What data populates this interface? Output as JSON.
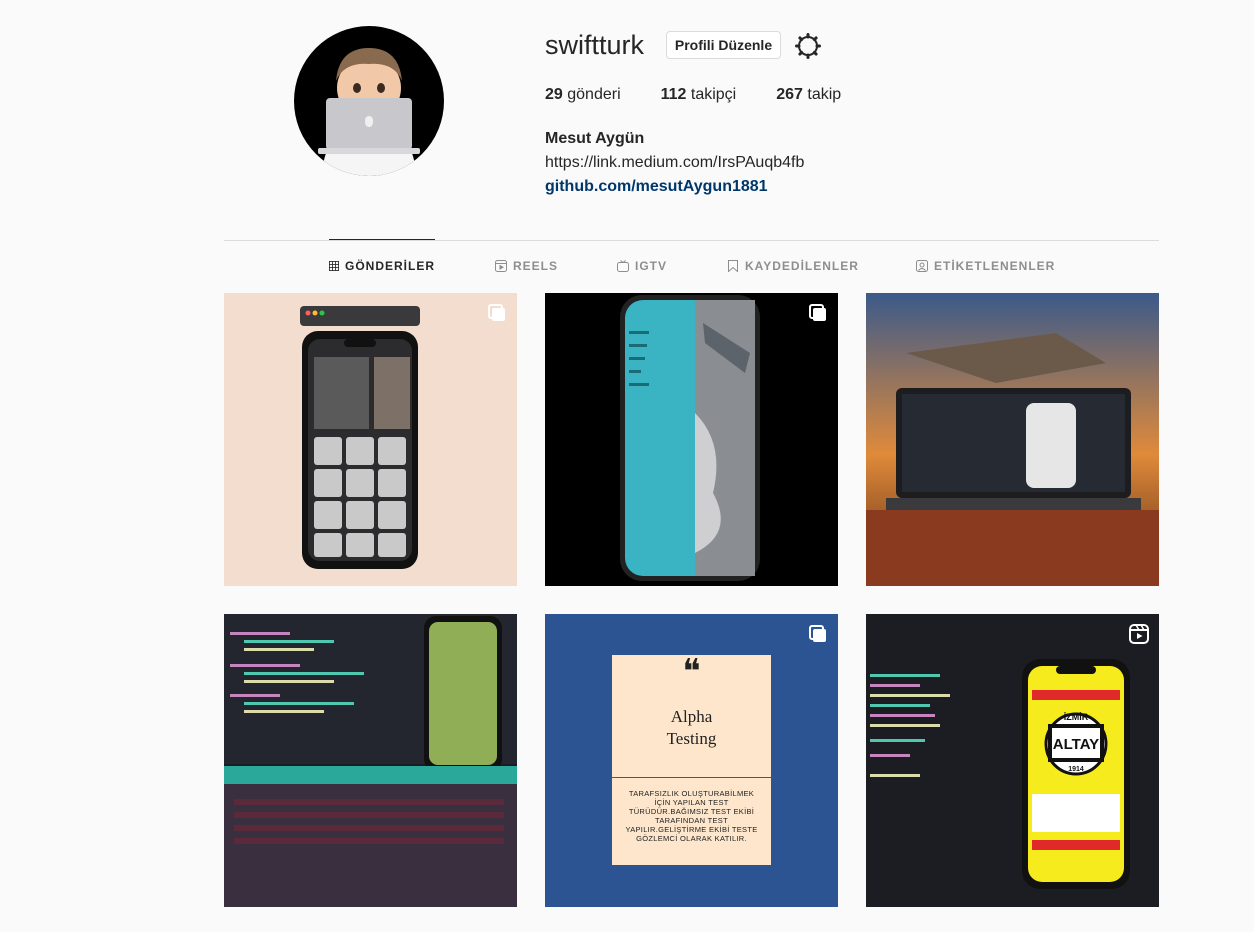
{
  "profile": {
    "username": "swiftturk",
    "edit_label": "Profili Düzenle",
    "stats": [
      {
        "count": "29",
        "label": " gönderi"
      },
      {
        "count": "112",
        "label": " takipçi"
      },
      {
        "count": "267",
        "label": " takip"
      }
    ],
    "full_name": "Mesut Aygün",
    "bio_line": "https://link.medium.com/IrsPAuqb4fb",
    "website": "github.com/mesutAygun1881"
  },
  "tabs": [
    {
      "label": "GÖNDERİLER",
      "icon": "grid-icon",
      "active": true
    },
    {
      "label": "REELS",
      "icon": "reels-icon",
      "active": false
    },
    {
      "label": "IGTV",
      "icon": "igtv-icon",
      "active": false
    },
    {
      "label": "KAYDEDİLENLER",
      "icon": "bookmark-icon",
      "active": false
    },
    {
      "label": "ETİKETLENENLER",
      "icon": "tagged-icon",
      "active": false
    }
  ],
  "posts": [
    {
      "type": "carousel",
      "badge_icon": "carousel-icon"
    },
    {
      "type": "carousel",
      "badge_icon": "carousel-icon"
    },
    {
      "type": "image"
    },
    {
      "type": "image"
    },
    {
      "type": "carousel",
      "badge_icon": "carousel-icon"
    },
    {
      "type": "reel",
      "badge_icon": "reel-icon"
    }
  ],
  "post_text": {
    "alpha_quote": "❝",
    "alpha_title_1": "Alpha",
    "alpha_title_2": "Testing",
    "alpha_body": "TARAFSIZLIK OLUŞTURABİLMEK İÇİN YAPILAN TEST TÜRÜDÜR.BAĞIMSIZ TEST EKİBİ TARAFINDAN TEST YAPILIR.GELİŞTİRME EKİBİ TESTE GÖZLEMCİ OLARAK KATILIR.",
    "altay_top": "İZMİR",
    "altay_name": "ALTAY",
    "altay_year": "1914"
  },
  "colors": {
    "link": "#00376b",
    "alpha_bg": "#2d5492",
    "alpha_card": "#fde6cc",
    "phone_teal": "#3ab3c3",
    "reel_yellow": "#f6ec1d"
  }
}
